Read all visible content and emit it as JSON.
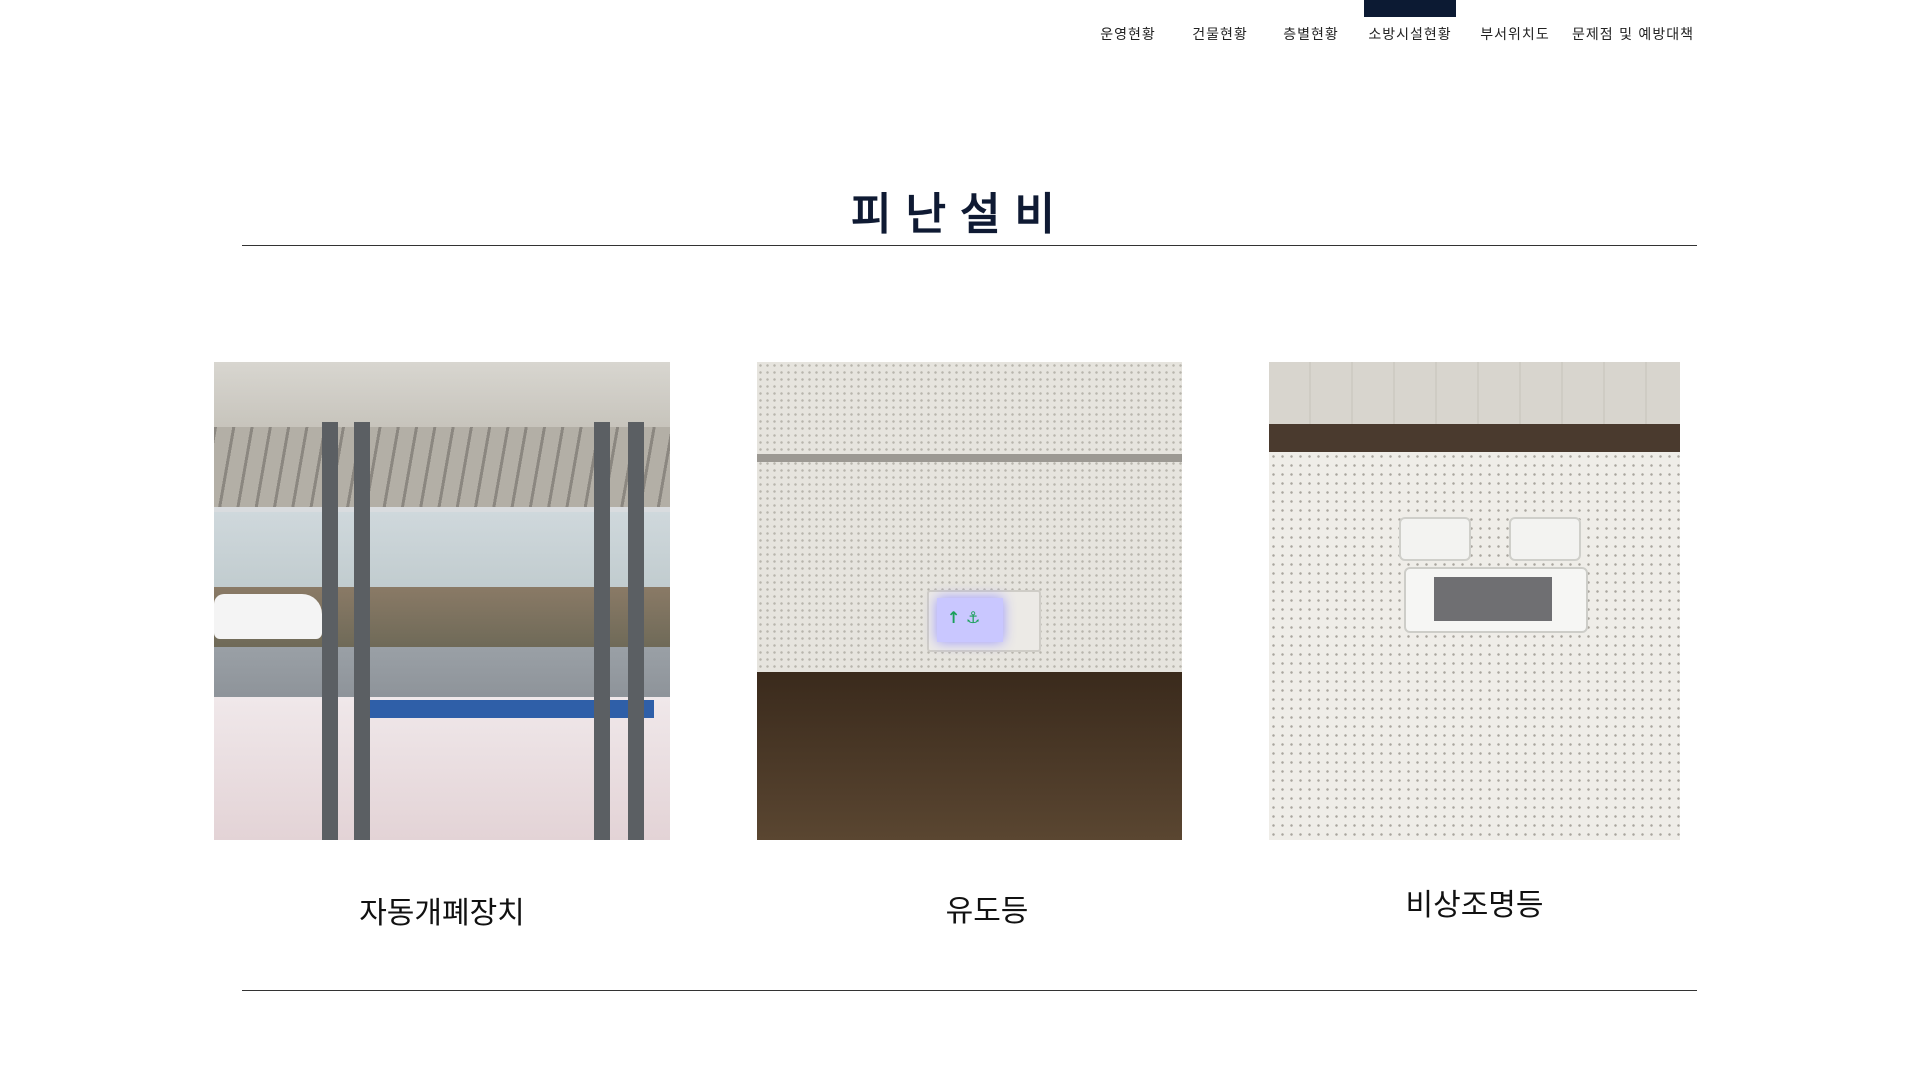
{
  "nav": {
    "items": [
      {
        "label": "운영현황"
      },
      {
        "label": "건물현황"
      },
      {
        "label": "층별현황"
      },
      {
        "label": "소방시설현황"
      },
      {
        "label": "부서위치도"
      },
      {
        "label": "문제점 및 예방대책"
      }
    ],
    "active": "소방시설현황"
  },
  "section": {
    "title": "피난설비"
  },
  "cards": [
    {
      "caption": "자동개폐장치",
      "image": "automatic-door-photo"
    },
    {
      "caption": "유도등",
      "image": "exit-light-photo"
    },
    {
      "caption": "비상조명등",
      "image": "emergency-light-photo"
    }
  ],
  "colors": {
    "accent": "#0c1a33",
    "rule": "#333333",
    "text": "#111111"
  }
}
